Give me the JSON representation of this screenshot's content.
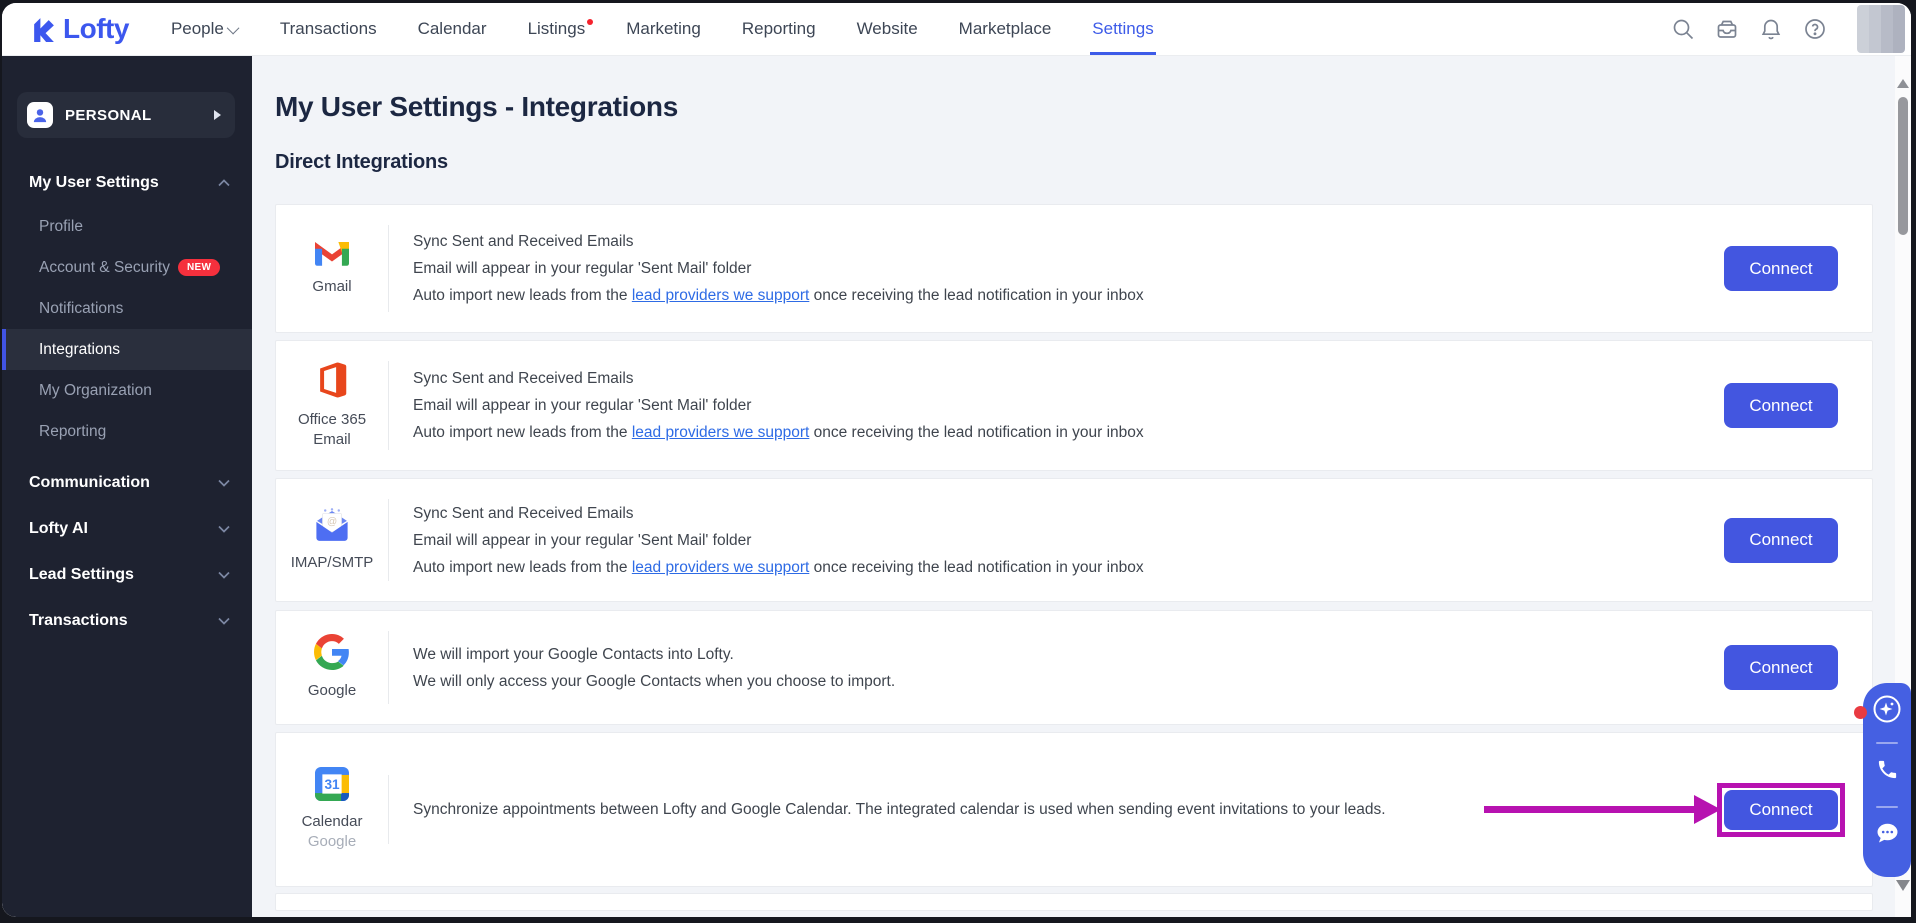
{
  "nav": {
    "logo_text": "Lofty",
    "items": [
      "People",
      "Transactions",
      "Calendar",
      "Listings",
      "Marketing",
      "Reporting",
      "Website",
      "Marketplace",
      "Settings"
    ],
    "active_item": "Settings"
  },
  "sidebar": {
    "workspace": "PERSONAL",
    "sections": [
      {
        "label": "My User Settings",
        "expanded": true,
        "items": [
          {
            "label": "Profile"
          },
          {
            "label": "Account & Security",
            "badge": "NEW"
          },
          {
            "label": "Notifications"
          },
          {
            "label": "Integrations",
            "active": true
          },
          {
            "label": "My Organization"
          },
          {
            "label": "Reporting"
          }
        ]
      },
      {
        "label": "Communication",
        "expanded": false
      },
      {
        "label": "Lofty AI",
        "expanded": false
      },
      {
        "label": "Lead Settings",
        "expanded": false
      },
      {
        "label": "Transactions",
        "expanded": false
      }
    ]
  },
  "main": {
    "title": "My User Settings - Integrations",
    "section_heading": "Direct Integrations",
    "integrations": [
      {
        "name": "Gmail",
        "line1": "Sync Sent and Received Emails",
        "line2": "Email will appear in your regular 'Sent Mail' folder",
        "line3_pre": "Auto import new leads from the ",
        "line3_link": "lead providers we support",
        "line3_post": " once receiving the lead notification in your inbox",
        "button": "Connect"
      },
      {
        "name_line1": "Office 365",
        "name_line2": "Email",
        "line1": "Sync Sent and Received Emails",
        "line2": "Email will appear in your regular 'Sent Mail' folder",
        "line3_pre": "Auto import new leads from the ",
        "line3_link": "lead providers we support",
        "line3_post": " once receiving the lead notification in your inbox",
        "button": "Connect"
      },
      {
        "name": "IMAP/SMTP",
        "line1": "Sync Sent and Received Emails",
        "line2": "Email will appear in your regular 'Sent Mail' folder",
        "line3_pre": "Auto import new leads from the ",
        "line3_link": "lead providers we support",
        "line3_post": " once receiving the lead notification in your inbox",
        "button": "Connect"
      },
      {
        "name": "Google",
        "line1": "We will import your Google Contacts into Lofty.",
        "line2": "We will only access your Google Contacts when you choose to import.",
        "button": "Connect"
      },
      {
        "name": "Calendar",
        "subname": "Google",
        "line1": "Synchronize appointments between Lofty and Google Calendar. The integrated calendar is used when sending event invitations to your leads.",
        "button": "Connect",
        "highlighted": true
      }
    ]
  },
  "annotation": {
    "arrow_color": "#b712b0"
  },
  "colors": {
    "accent": "#4356e0",
    "badge": "#f5303d",
    "sidebar_bg": "#1e2230"
  }
}
